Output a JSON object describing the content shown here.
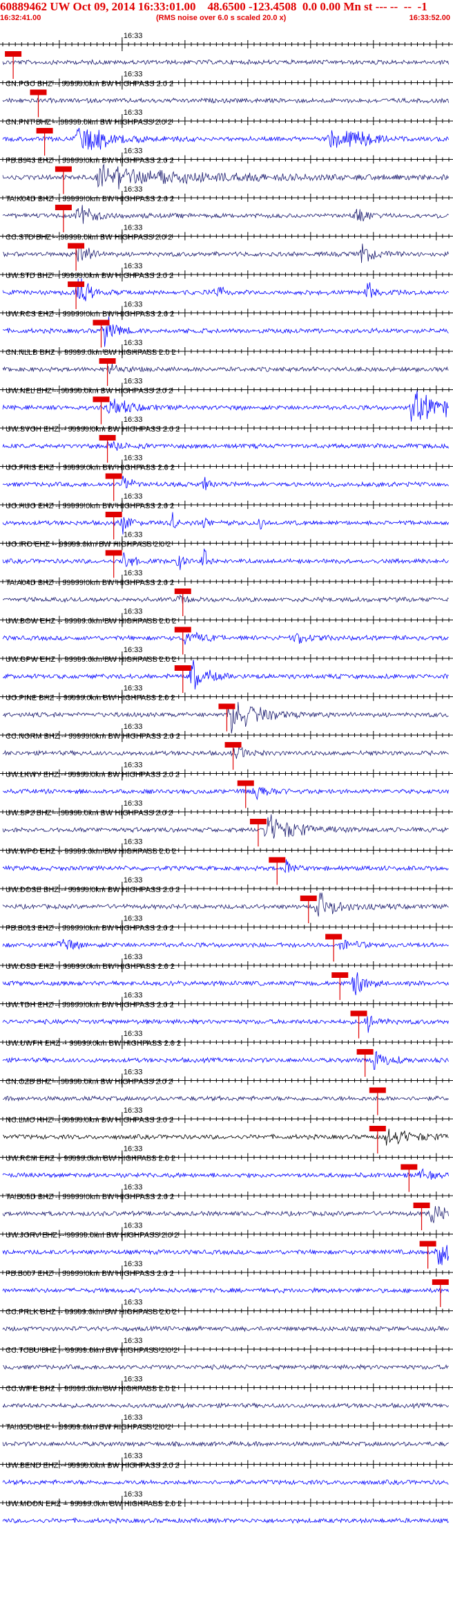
{
  "header": {
    "title": "60889462 UW Oct 09, 2014 16:33:01.00    48.6500 -123.4508  0.0 0.00 Mn st --- --  --  -1",
    "start_time": "16:32:41.00",
    "rms_note": "(RMS noise over 6.0 s scaled 20.0 x)",
    "end_time": "16:33:52.00"
  },
  "colors": {
    "trace_blue": "#0000ff",
    "trace_navy": "#1a1a6e",
    "trace_black": "#000000",
    "pick_red": "#e00000",
    "axis": "#000000",
    "header_red": "#e00000"
  },
  "chart_data": {
    "type": "line",
    "x_axis": {
      "start": "16:32:41.00",
      "end": "16:33:52.00",
      "minute_label": "16:33",
      "minute_offset_s": 19,
      "span_s": 71,
      "tick_interval_s": 1
    },
    "traces": [
      {
        "label": "",
        "color": "navy",
        "pick_s": 1,
        "events": []
      },
      {
        "label": "CN.PGC BHZ -- 99999.0km BW  HIGHPASS  2.0  2",
        "color": "navy",
        "pick_s": 5,
        "events": []
      },
      {
        "label": "CN.PNT BHZ -- 99999.0km BW  HIGHPASS  2.0  2",
        "color": "blue",
        "pick_s": 6,
        "events": [
          [
            12,
            1.0,
            4
          ],
          [
            52,
            0.6,
            3
          ],
          [
            55,
            0.5,
            3
          ]
        ]
      },
      {
        "label": "PB.B943 EHZ -- 99999.0km BW  HIGHPASS  2.0  2",
        "color": "navy",
        "pick_s": 9,
        "events": [
          [
            15,
            0.6,
            16
          ]
        ]
      },
      {
        "label": "TA.K04D BHZ -- 99999.0km BW  HIGHPASS  2.0  2",
        "color": "navy",
        "pick_s": 9,
        "events": [
          [
            12,
            0.8,
            2
          ],
          [
            56,
            0.5,
            1.5
          ]
        ]
      },
      {
        "label": "CC.STD BHZ -- 99999.0km BW  HIGHPASS  2.0  2",
        "color": "navy",
        "pick_s": 11,
        "events": [
          [
            12,
            0.9,
            1.5
          ],
          [
            57,
            0.7,
            1.5
          ]
        ]
      },
      {
        "label": "UW.STD BHZ -- 99999.0km BW  HIGHPASS  2.0  2",
        "color": "blue",
        "pick_s": 11,
        "events": [
          [
            12,
            1.0,
            1.5
          ],
          [
            34,
            0.5,
            1
          ],
          [
            58,
            0.6,
            1
          ]
        ]
      },
      {
        "label": "UW.RCS EHZ -- 99999.0km BW  HIGHPASS  2.0  2",
        "color": "blue",
        "pick_s": 15,
        "events": [
          [
            16,
            1.0,
            1.5
          ]
        ]
      },
      {
        "label": "CN.NLLB BHZ -- 99999.0km BW  HIGHPASS  2.0  2",
        "color": "navy",
        "pick_s": 16,
        "events": [
          [
            17,
            0.4,
            1.5
          ]
        ]
      },
      {
        "label": "UW.NEL EHZ -- 99999.0km BW  HIGHPASS  2.0  2",
        "color": "blue",
        "pick_s": 15,
        "events": [
          [
            17,
            0.5,
            3
          ],
          [
            65,
            1.0,
            5
          ]
        ]
      },
      {
        "label": "UW.SVOH EHZ -- 99999.0km BW  HIGHPASS  2.0  2",
        "color": "blue",
        "pick_s": 16,
        "events": [
          [
            17,
            0.3,
            2
          ]
        ]
      },
      {
        "label": "UO.FRIS EHZ -- 99999.0km BW  HIGHPASS  2.0  2",
        "color": "blue",
        "pick_s": 17,
        "events": [
          [
            19,
            0.8,
            1
          ],
          [
            32,
            0.6,
            0.5
          ]
        ]
      },
      {
        "label": "UO.HUO EHZ -- 99999.0km BW  HIGHPASS  2.0  2",
        "color": "blue",
        "pick_s": 17,
        "events": [
          [
            19,
            0.9,
            1
          ],
          [
            27,
            0.7,
            0.5
          ],
          [
            32,
            0.7,
            0.5
          ],
          [
            41,
            0.4,
            0.5
          ]
        ]
      },
      {
        "label": "UO.IRO EHZ -- 99999.0km BW  HIGHPASS  2.0  2",
        "color": "blue",
        "pick_s": 17,
        "events": [
          [
            19,
            1.0,
            1
          ],
          [
            28,
            0.8,
            0.5
          ],
          [
            32,
            0.8,
            0.5
          ]
        ]
      },
      {
        "label": "TA.A04D BHZ -- 99999.0km BW  HIGHPASS  2.0  2",
        "color": "navy",
        "pick_s": 28,
        "events": [
          [
            28,
            0.3,
            1
          ]
        ]
      },
      {
        "label": "UW.BOW EHZ -- 99999.0km BW  HIGHPASS  2.0  2",
        "color": "blue",
        "pick_s": 28,
        "events": [
          [
            29,
            0.5,
            2
          ],
          [
            46,
            0.4,
            2
          ]
        ]
      },
      {
        "label": "UW.GPW EHZ -- 99999.0km BW  HIGHPASS  2.0  2",
        "color": "blue",
        "pick_s": 28,
        "events": [
          [
            30,
            1.0,
            2
          ]
        ]
      },
      {
        "label": "UO.PINE BHZ -- 99999.0km BW  HIGHPASS  2.0  2",
        "color": "navy",
        "pick_s": 35,
        "events": [
          [
            36,
            1.0,
            4
          ]
        ]
      },
      {
        "label": "CC.NORM BHZ -- 99999.0km BW  HIGHPASS  2.0  2",
        "color": "navy",
        "pick_s": 36,
        "events": [
          [
            37,
            0.5,
            1.5
          ]
        ]
      },
      {
        "label": "UW.LKWY EHZ -- 99999.0km BW  HIGHPASS  2.0  2",
        "color": "blue",
        "pick_s": 38,
        "events": [
          [
            40,
            0.5,
            2
          ]
        ]
      },
      {
        "label": "UW.SP2 BHZ -- 99999.0km BW  HIGHPASS  2.0  2",
        "color": "navy",
        "pick_s": 40,
        "events": [
          [
            42,
            0.9,
            4
          ]
        ]
      },
      {
        "label": "UW.WPO EHZ -- 99999.0km BW  HIGHPASS  2.0  2",
        "color": "blue",
        "pick_s": 43,
        "events": [
          [
            45,
            0.5,
            1
          ]
        ]
      },
      {
        "label": "UW.DOSE BHZ -- 99999.0km BW  HIGHPASS  2.0  2",
        "color": "navy",
        "pick_s": 48,
        "events": [
          [
            50,
            0.8,
            3
          ]
        ]
      },
      {
        "label": "PB.B013 EHZ -- 99999.0km BW  HIGHPASS  2.0  2",
        "color": "blue",
        "pick_s": 52,
        "events": [
          [
            9,
            0.4,
            2
          ],
          [
            54,
            0.5,
            1.5
          ]
        ]
      },
      {
        "label": "UW.OSD EHZ -- 99999.0km BW  HIGHPASS  2.0  2",
        "color": "blue",
        "pick_s": 53,
        "events": [
          [
            56,
            0.9,
            1.5
          ]
        ]
      },
      {
        "label": "UW.TDH EHZ -- 99999.0km BW  HIGHPASS  2.0  2",
        "color": "blue",
        "pick_s": 56,
        "events": [
          [
            58,
            0.5,
            1.5
          ]
        ]
      },
      {
        "label": "UW.UWFH EHZ -- 99999.0km BW  HIGHPASS  2.0  2",
        "color": "blue",
        "pick_s": 57,
        "events": [
          [
            59,
            0.6,
            2
          ]
        ]
      },
      {
        "label": "CN.OZB BHZ -- 99999.0km BW  HIGHPASS  2.0  2",
        "color": "navy",
        "pick_s": 59,
        "events": []
      },
      {
        "label": "NC.LMC HHZ -- 99999.0km BW  HIGHPASS  2.0  2",
        "color": "black",
        "pick_s": 59,
        "events": [
          [
            61,
            0.5,
            4
          ]
        ]
      },
      {
        "label": "UW.RCM EHZ -- 99999.0km BW  HIGHPASS  2.0  2",
        "color": "blue",
        "pick_s": 64,
        "events": [
          [
            66,
            0.3,
            2
          ]
        ]
      },
      {
        "label": "TA.B05D BHZ -- 99999.0km BW  HIGHPASS  2.0  2",
        "color": "navy",
        "pick_s": 66,
        "events": [
          [
            68,
            0.7,
            2
          ]
        ]
      },
      {
        "label": "UW.JORV EHZ -- 99999.0km BW  HIGHPASS  2.0  2",
        "color": "blue",
        "pick_s": 67,
        "events": [
          [
            69,
            1.0,
            2
          ]
        ]
      },
      {
        "label": "PB.B007 EHZ -- 99999.0km BW  HIGHPASS  2.0  2",
        "color": "blue",
        "pick_s": 69,
        "events": []
      },
      {
        "label": "CC.PRLK BHZ -- 99999.0km BW  HIGHPASS  2.0  2",
        "color": "navy",
        "pick_s": null,
        "events": []
      },
      {
        "label": "CC.TCBU BHZ -- 99999.0km BW  HIGHPASS  2.0  2",
        "color": "navy",
        "pick_s": null,
        "events": []
      },
      {
        "label": "CC.WIFE BHZ -- 99999.0km BW  HIGHPASS  2.0  2",
        "color": "navy",
        "pick_s": null,
        "events": []
      },
      {
        "label": "TA.I05D BHZ -- 99999.0km BW  HIGHPASS  2.0  2",
        "color": "navy",
        "pick_s": null,
        "events": []
      },
      {
        "label": "UW.BEND EHZ -- 99999.0km BW  HIGHPASS  2.0  2",
        "color": "blue",
        "pick_s": null,
        "events": []
      },
      {
        "label": "UW.MOON EHZ -- 99999.0km BW  HIGHPASS  2.0  2",
        "color": "blue",
        "pick_s": null,
        "events": []
      }
    ]
  }
}
